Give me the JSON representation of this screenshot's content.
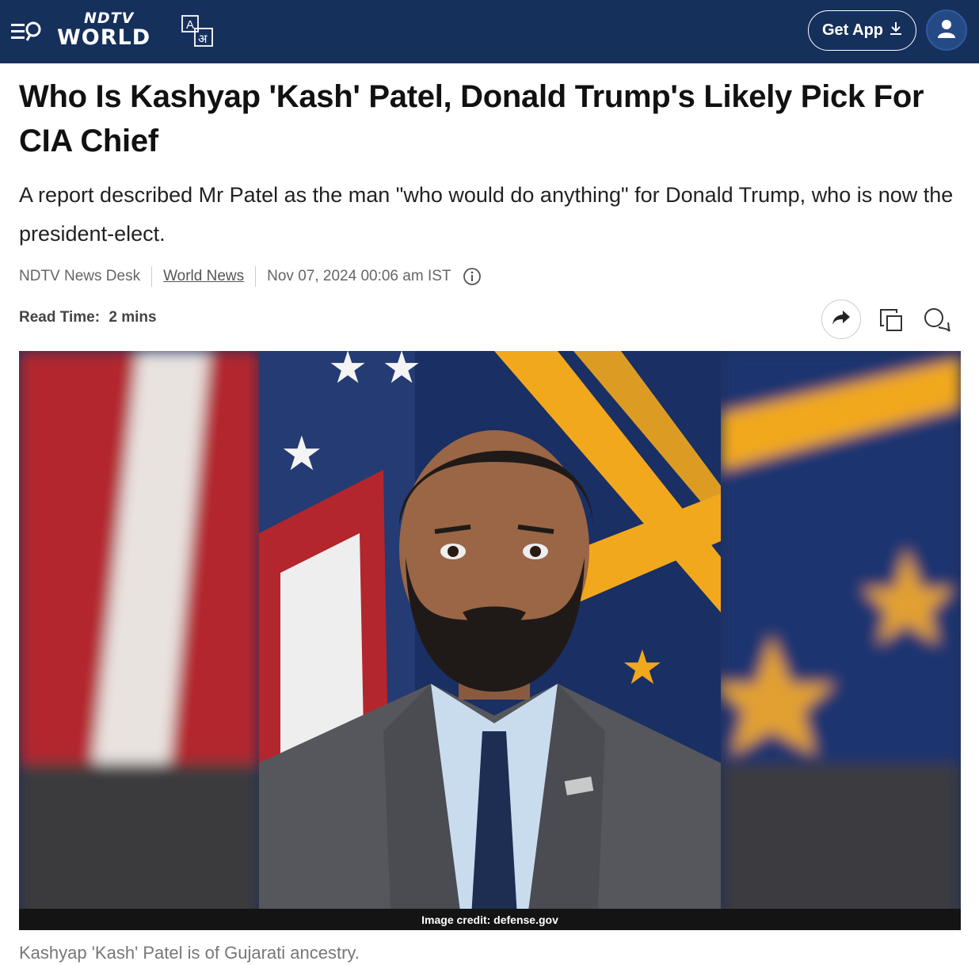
{
  "header": {
    "logo_top": "NDTV",
    "logo_bottom": "WORLD",
    "get_app_label": "Get App",
    "lang_a": "A",
    "lang_hi": "अ"
  },
  "article": {
    "headline": "Who Is Kashyap 'Kash' Patel, Donald Trump's Likely Pick For CIA Chief",
    "summary": "A report described Mr Patel as the man \"who would do anything\" for Donald Trump, who is now the president-elect.",
    "author": "NDTV News Desk",
    "category": "World News",
    "timestamp": "Nov 07, 2024 00:06 am IST",
    "read_time_label": "Read Time:",
    "read_time_value": "2 mins"
  },
  "image": {
    "credit": "Image credit: defense.gov",
    "caption": "Kashyap 'Kash' Patel is of Gujarati ancestry."
  },
  "colors": {
    "header_bg": "#16305c",
    "accent_gold": "#f2a81d",
    "flag_blue": "#1f3a78",
    "flag_red": "#b3262d"
  },
  "icons": {
    "menu": "menu-search-icon",
    "lang": "language-toggle-icon",
    "download": "download-icon",
    "user": "user-icon",
    "info": "info-icon",
    "share": "share-icon",
    "copy": "copy-icon",
    "comment": "comment-icon"
  }
}
